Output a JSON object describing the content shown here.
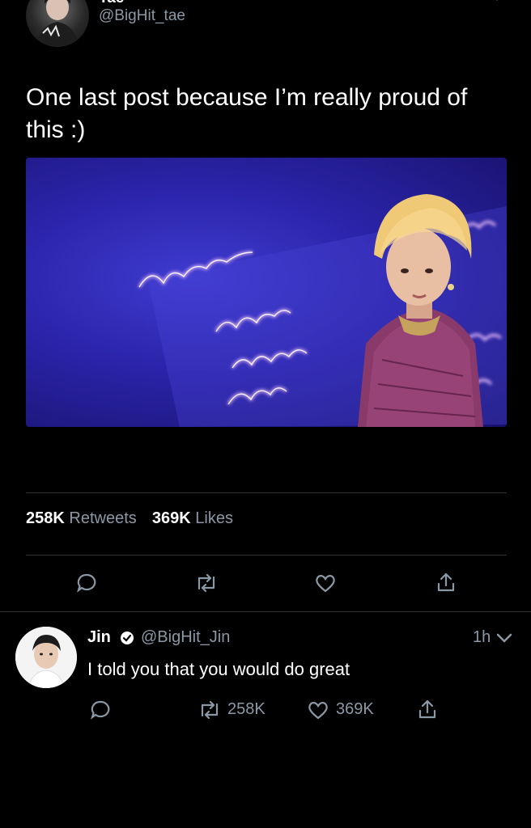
{
  "main_tweet": {
    "name_partial": "Tae",
    "handle": "@BigHit_tae",
    "text": "One last post because I’m really proud of this :)",
    "retweets_count": "258K",
    "retweets_label": "Retweets",
    "likes_count": "369K",
    "likes_label": "Likes",
    "actions": [
      "reply-icon",
      "retweet-icon",
      "like-icon",
      "share-icon"
    ]
  },
  "reply": {
    "name": "Jin",
    "handle": "@BigHit_Jin",
    "time": "1h",
    "text": "I told you that you would do great",
    "retweets": "258K",
    "likes": "369K",
    "actions": [
      "reply-icon",
      "retweet-icon",
      "like-icon",
      "share-icon"
    ]
  },
  "colors": {
    "background": "#000000",
    "text": "#ffffff",
    "muted": "#8b98a5",
    "divider": "#2f3336",
    "verified": "#ffffff"
  }
}
